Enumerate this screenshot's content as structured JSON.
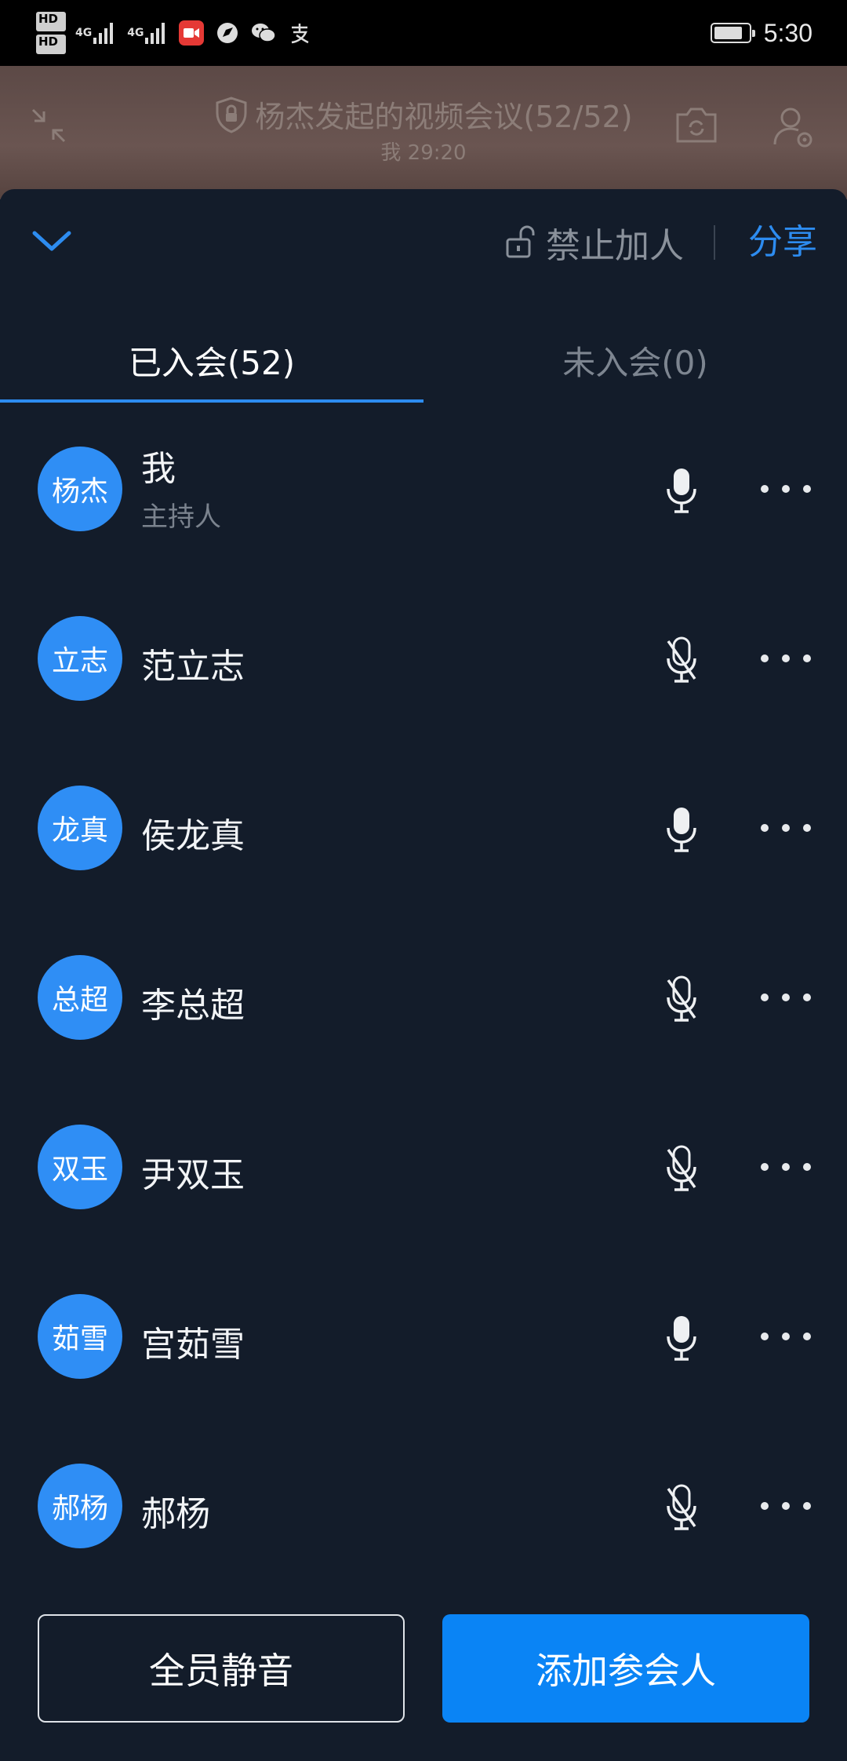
{
  "status_bar": {
    "hd1": "HD",
    "hd1_sub": "1",
    "hd2": "HD",
    "hd2_sub": "2",
    "net1": "4G",
    "net2": "4G",
    "time": "5:30",
    "battery_level": 0.8,
    "icons": [
      "video-app-icon",
      "browser-icon",
      "wechat-icon",
      "alipay-icon"
    ]
  },
  "meeting": {
    "title": "杨杰发起的视频会议(52/52)",
    "subtitle": "我 29:20"
  },
  "sheet": {
    "forbid_label": "禁止加人",
    "share_label": "分享"
  },
  "tabs": {
    "joined": "已入会(52)",
    "not_joined": "未入会(0)"
  },
  "participants": [
    {
      "avatar": "杨杰",
      "name": "我",
      "role": "主持人",
      "mic_on": true
    },
    {
      "avatar": "立志",
      "name": "范立志",
      "role": "",
      "mic_on": false
    },
    {
      "avatar": "龙真",
      "name": "侯龙真",
      "role": "",
      "mic_on": true
    },
    {
      "avatar": "总超",
      "name": "李总超",
      "role": "",
      "mic_on": false
    },
    {
      "avatar": "双玉",
      "name": "尹双玉",
      "role": "",
      "mic_on": false
    },
    {
      "avatar": "茹雪",
      "name": "宫茹雪",
      "role": "",
      "mic_on": true
    },
    {
      "avatar": "郝杨",
      "name": "郝杨",
      "role": "",
      "mic_on": false
    }
  ],
  "footer": {
    "mute_all": "全员静音",
    "add_participant": "添加参会人"
  },
  "colors": {
    "accent": "#2d8cf0",
    "avatar": "#2f8ef5",
    "sheet_bg": "#131c2a",
    "primary_button": "#0a84f5"
  }
}
